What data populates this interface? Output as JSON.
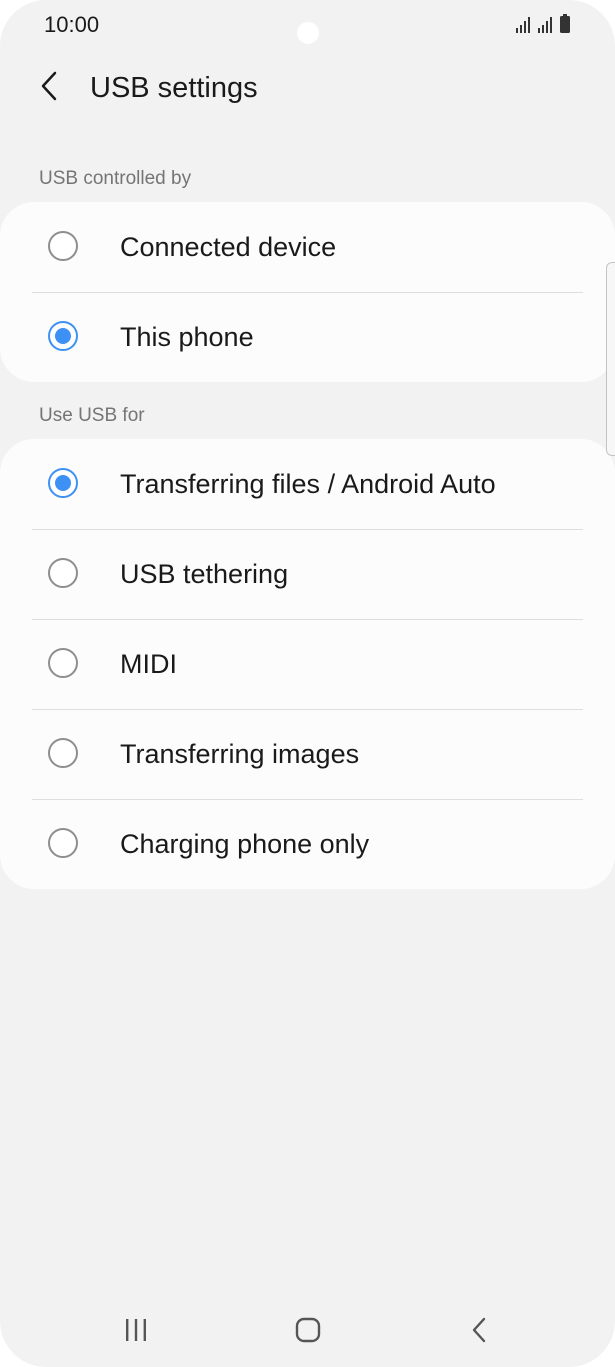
{
  "status_bar": {
    "time": "10:00",
    "icons": [
      "signal-icon",
      "signal-icon",
      "battery-icon"
    ]
  },
  "header": {
    "back_icon": "chevron-left-icon",
    "title": "USB settings"
  },
  "sections": [
    {
      "label": "USB controlled by",
      "options": [
        {
          "label": "Connected device",
          "selected": false
        },
        {
          "label": "This phone",
          "selected": true
        }
      ]
    },
    {
      "label": "Use USB for",
      "options": [
        {
          "label": "Transferring files / Android Auto",
          "selected": true
        },
        {
          "label": "USB tethering",
          "selected": false
        },
        {
          "label": "MIDI",
          "selected": false
        },
        {
          "label": "Transferring images",
          "selected": false
        },
        {
          "label": "Charging phone only",
          "selected": false
        }
      ]
    }
  ],
  "nav_bar": {
    "icons": [
      "recent-apps-icon",
      "home-icon",
      "back-icon"
    ]
  },
  "colors": {
    "accent": "#3e91f4",
    "background": "#f2f2f2",
    "card": "#fcfcfc"
  }
}
